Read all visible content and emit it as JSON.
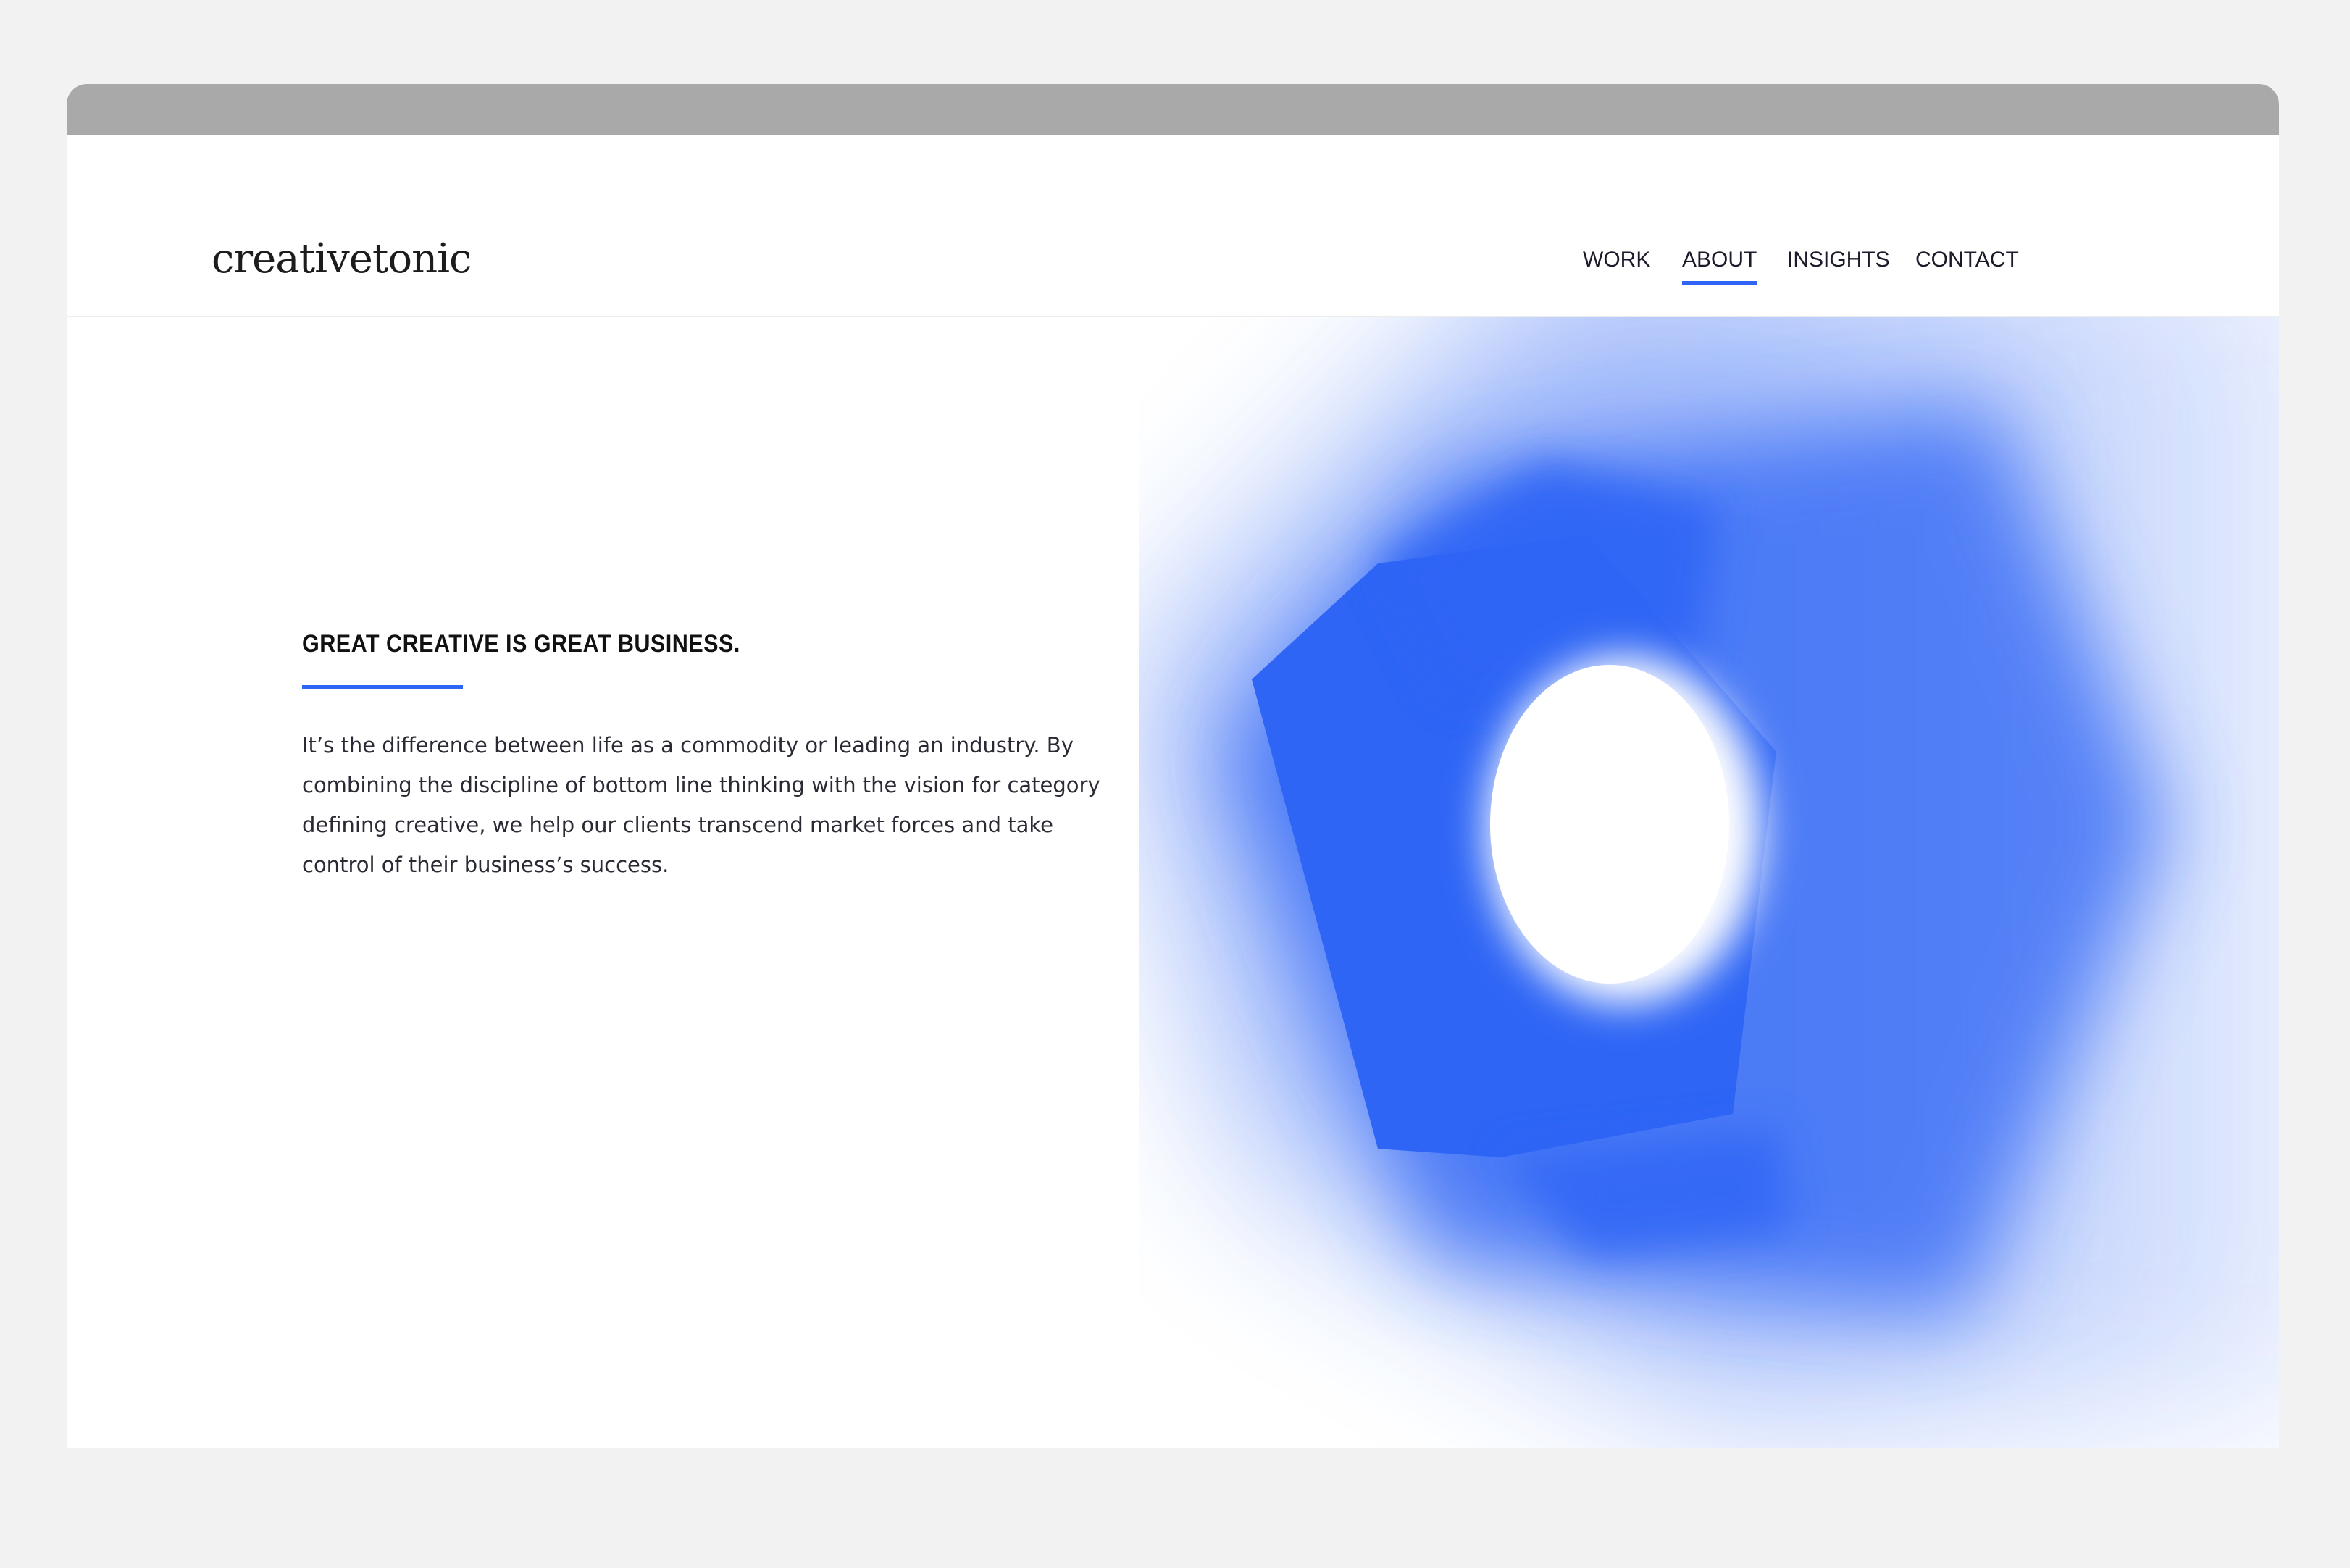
{
  "site": {
    "logo": "creativetonic"
  },
  "nav": {
    "items": [
      {
        "label": "WORK",
        "active": false
      },
      {
        "label": "ABOUT",
        "active": true
      },
      {
        "label": "INSIGHTS",
        "active": false
      },
      {
        "label": "CONTACT",
        "active": false
      }
    ]
  },
  "hero": {
    "headline": "GREAT CREATIVE IS GREAT BUSINESS.",
    "body": "It’s the difference between life as a commodity or leading an industry. By combining the discipline of bottom line thinking with the vision for category defining creative, we help our clients transcend market forces and take control of their business’s success."
  },
  "colors": {
    "accent": "#2e65f5",
    "chrome": "#a9a9a9",
    "background": "#f2f2f2"
  }
}
